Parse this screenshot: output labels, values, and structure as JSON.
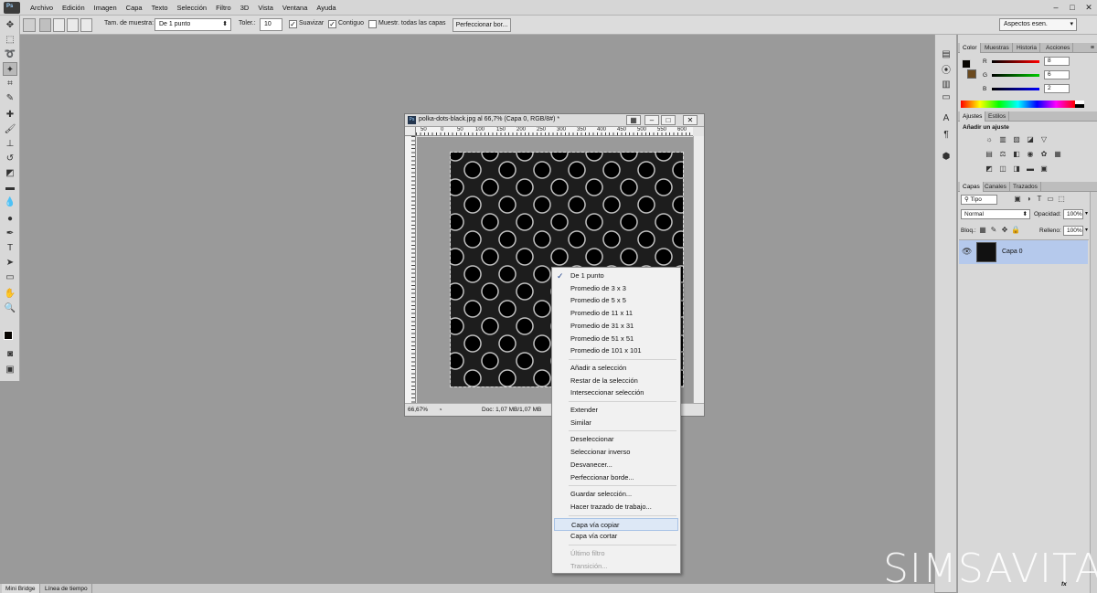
{
  "menubar": {
    "app_icon": "Ps",
    "items": [
      "Archivo",
      "Edición",
      "Imagen",
      "Capa",
      "Texto",
      "Selección",
      "Filtro",
      "3D",
      "Vista",
      "Ventana",
      "Ayuda"
    ],
    "minimize": "–",
    "maximize": "□",
    "close": "✕"
  },
  "options": {
    "sample_size_label": "Tam. de muestra:",
    "sample_size_value": "De 1 punto",
    "tolerance_label": "Toler.:",
    "tolerance_value": "10",
    "smooth_label": "Suavizar",
    "smooth_checked": true,
    "contiguous_label": "Contiguo",
    "contiguous_checked": true,
    "all_layers_label": "Muestr. todas las capas",
    "all_layers_checked": false,
    "refine_button": "Perfeccionar bor...",
    "workspace": "Aspectos esen."
  },
  "document": {
    "title": "polka-dots-black.jpg al 66,7% (Capa 0, RGB/8#) *",
    "ruler_ticks": [
      "50",
      "0",
      "50",
      "100",
      "150",
      "200",
      "250",
      "300",
      "350",
      "400",
      "450",
      "500",
      "550",
      "600"
    ],
    "zoom": "66,67%",
    "doc_info": "Doc: 1,07 MB/1,07 MB"
  },
  "context_menu": {
    "items": [
      {
        "label": "De 1 punto",
        "checked": true,
        "enabled": true
      },
      {
        "label": "Promedio de 3 x 3",
        "enabled": true
      },
      {
        "label": "Promedio de 5 x 5",
        "enabled": true
      },
      {
        "label": "Promedio de 11 x 11",
        "enabled": true
      },
      {
        "label": "Promedio de 31 x 31",
        "enabled": true
      },
      {
        "label": "Promedio de 51 x 51",
        "enabled": true
      },
      {
        "label": "Promedio de 101 x 101",
        "enabled": true
      },
      {
        "separator": true
      },
      {
        "label": "Añadir a selección",
        "enabled": true
      },
      {
        "label": "Restar de la selección",
        "enabled": true
      },
      {
        "label": "Interseccionar selección",
        "enabled": true
      },
      {
        "separator": true
      },
      {
        "label": "Extender",
        "enabled": true
      },
      {
        "label": "Similar",
        "enabled": true
      },
      {
        "separator": true
      },
      {
        "label": "Deseleccionar",
        "enabled": true
      },
      {
        "label": "Seleccionar inverso",
        "enabled": true
      },
      {
        "label": "Desvanecer...",
        "enabled": true
      },
      {
        "label": "Perfeccionar borde...",
        "enabled": true
      },
      {
        "separator": true
      },
      {
        "label": "Guardar selección...",
        "enabled": true
      },
      {
        "label": "Hacer trazado de trabajo...",
        "enabled": true
      },
      {
        "separator": true
      },
      {
        "label": "Capa vía copiar",
        "enabled": true,
        "highlighted": true
      },
      {
        "label": "Capa vía cortar",
        "enabled": true
      },
      {
        "separator": true
      },
      {
        "label": "Último filtro",
        "enabled": false
      },
      {
        "label": "Transición...",
        "enabled": false
      }
    ]
  },
  "color_panel": {
    "tabs": [
      "Color",
      "Muestras",
      "Historia",
      "Acciones"
    ],
    "r_label": "R",
    "g_label": "G",
    "b_label": "B",
    "r": "8",
    "g": "6",
    "b": "2",
    "foreground": "#080602",
    "background": "#6b4a1e"
  },
  "adjust_panel": {
    "tabs": [
      "Ajustes",
      "Estilos"
    ],
    "heading": "Añadir un ajuste"
  },
  "layers_panel": {
    "tabs": [
      "Capas",
      "Canales",
      "Trazados"
    ],
    "filter": "Tipo",
    "blend_mode": "Normal",
    "opacity_label": "Opacidad:",
    "opacity": "100%",
    "lock_label": "Bloq.:",
    "fill_label": "Relleno:",
    "fill": "100%",
    "layer_name": "Capa 0",
    "footer_fx": "fx"
  },
  "bottom_tabs": [
    "Mini Bridge",
    "Línea de tiempo"
  ],
  "watermark": "SIMSAVITA",
  "colors": {
    "selection_highlight": "#b5c9ec",
    "check": "#1a3f8a"
  }
}
